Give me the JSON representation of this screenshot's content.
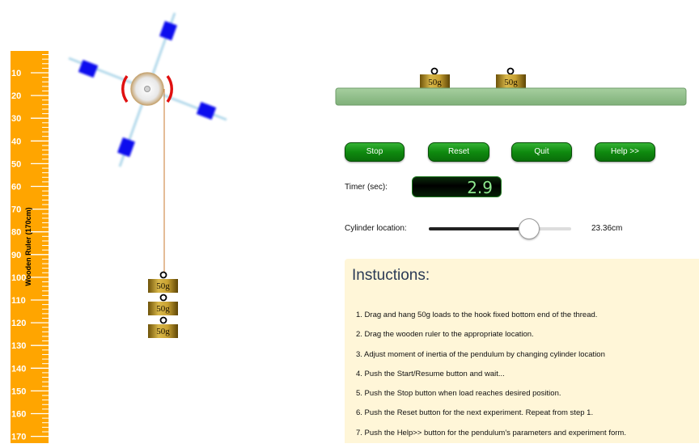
{
  "ruler": {
    "label": "Wooden Ruler (170cm)",
    "marks": [
      "10",
      "20",
      "30",
      "40",
      "50",
      "60",
      "70",
      "80",
      "90",
      "100",
      "110",
      "120",
      "130",
      "140",
      "150",
      "160",
      "170"
    ],
    "color": "#FFA500"
  },
  "weights": {
    "label": "50g",
    "hanging_count": 3,
    "stand_count": 2
  },
  "controls": {
    "stop_label": "Stop",
    "reset_label": "Reset",
    "quit_label": "Quit",
    "help_label": "Help >>",
    "button_color": "#0f8a0f"
  },
  "timer": {
    "label": "Timer (sec):",
    "value": "2.9"
  },
  "cylinder": {
    "label": "Cylinder location:",
    "value_text": "23.36cm",
    "slider_fraction": 0.7
  },
  "instructions": {
    "title": "Instuctions:",
    "steps": [
      "1. Drag and hang 50g loads to the hook fixed bottom end of the thread.",
      "2. Drag the wooden ruler to the appropriate location.",
      "3. Adjust moment of inertia of the pendulum by changing cylinder location",
      "4. Push the Start/Resume button and wait...",
      "5. Push the Stop button when load reaches desired position.",
      "6. Push the Reset button for the next experiment. Repeat from step 1.",
      "7. Push the Help>> button for the pendulum's parameters and experiment form."
    ]
  },
  "colors": {
    "shelf": "#8fbf8a",
    "weight_gold": "#b8941e",
    "cylinder_blue": "#1010ee",
    "brake_red": "#e01010",
    "panel_bg": "#fff6d8"
  }
}
